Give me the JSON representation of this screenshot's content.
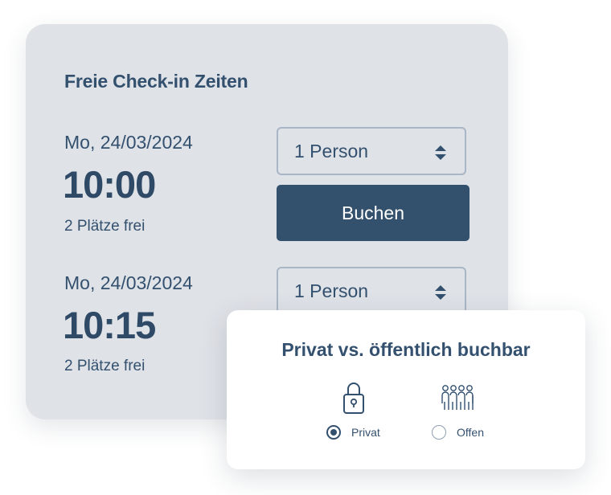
{
  "booking": {
    "title": "Freie Check-in Zeiten",
    "slots": [
      {
        "date": "Mo, 24/03/2024",
        "time": "10:00",
        "free": "2 Plätze frei",
        "persons": "1 Person",
        "button": "Buchen"
      },
      {
        "date": "Mo, 24/03/2024",
        "time": "10:15",
        "free": "2 Plätze frei",
        "persons": "1 Person"
      }
    ]
  },
  "privacy": {
    "title": "Privat vs. öffentlich buchbar",
    "options": [
      {
        "label": "Privat",
        "icon": "lock-icon",
        "selected": true
      },
      {
        "label": "Offen",
        "icon": "group-icon",
        "selected": false
      }
    ]
  },
  "colors": {
    "card_background": "#dfe2e7",
    "primary": "#33506d",
    "text": "#33506e",
    "select_border": "#a8b6c6"
  }
}
